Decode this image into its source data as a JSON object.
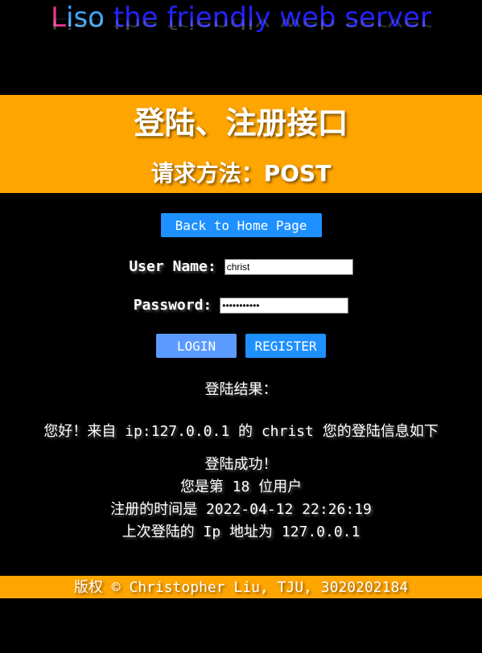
{
  "header": {
    "logo_part1": "L",
    "logo_part2": "iso",
    "logo_rest": " the friendly web server",
    "colors": {
      "pink": "#e8348c",
      "lightblue": "#3aa6ff",
      "blue": "#2222ff"
    }
  },
  "banner": {
    "title": "登陆、注册接口",
    "subtitle": "请求方法：POST",
    "background": "#ffa500"
  },
  "nav": {
    "home_label": "Back to Home Page"
  },
  "form": {
    "username_label": "User Name:",
    "username_value": "christ",
    "password_label": "Password:",
    "password_value": "christ12345"
  },
  "buttons": {
    "login_label": "LOGIN",
    "register_label": "REGISTER"
  },
  "result": {
    "title": "登陆结果：",
    "greeting": "您好！来自 ip:127.0.0.1 的 christ 您的登陆信息如下",
    "status": "登陆成功！",
    "user_number": "您是第 18 位用户",
    "register_time": "注册的时间是 2022-04-12 22:26:19",
    "last_ip": "上次登陆的 Ip 地址为 127.0.0.1"
  },
  "footer": {
    "copyright": "版权 © Christopher Liu, TJU, 3020202184"
  }
}
